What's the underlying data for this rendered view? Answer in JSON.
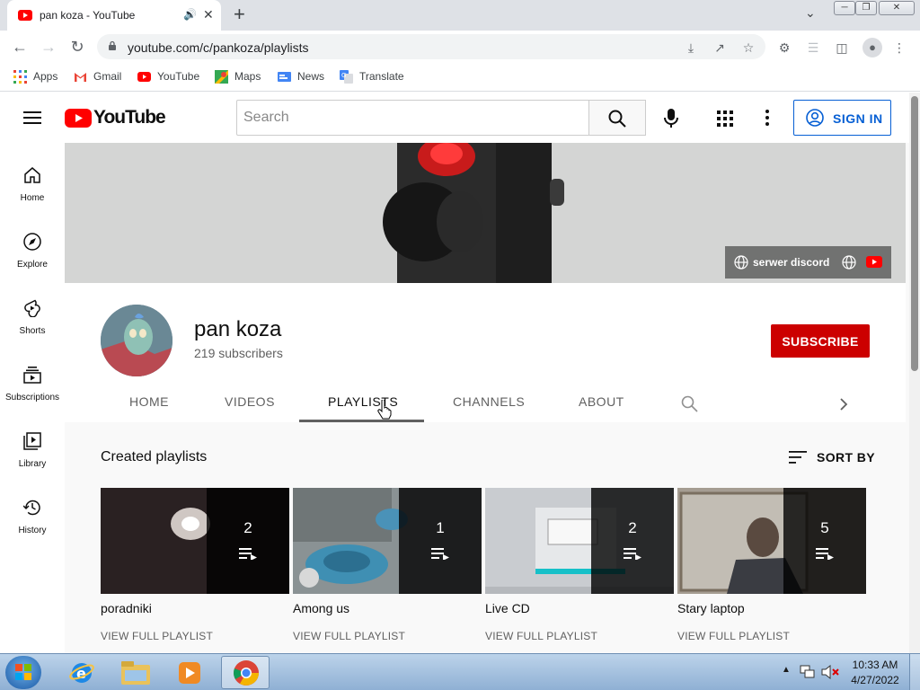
{
  "browser": {
    "tab_title": "pan koza - YouTube",
    "url": "youtube.com/c/pankoza/playlists",
    "bookmarks": [
      {
        "label": "Apps",
        "icon": "apps-grid-icon"
      },
      {
        "label": "Gmail",
        "icon": "gmail-icon"
      },
      {
        "label": "YouTube",
        "icon": "youtube-icon"
      },
      {
        "label": "Maps",
        "icon": "maps-icon"
      },
      {
        "label": "News",
        "icon": "news-icon"
      },
      {
        "label": "Translate",
        "icon": "translate-icon"
      }
    ]
  },
  "youtube": {
    "logo_text": "YouTube",
    "search_placeholder": "Search",
    "sign_in": "SIGN IN",
    "sidebar": [
      {
        "label": "Home",
        "icon": "home-icon"
      },
      {
        "label": "Explore",
        "icon": "explore-icon"
      },
      {
        "label": "Shorts",
        "icon": "shorts-icon"
      },
      {
        "label": "Subscriptions",
        "icon": "subscriptions-icon"
      },
      {
        "label": "Library",
        "icon": "library-icon"
      },
      {
        "label": "History",
        "icon": "history-icon"
      }
    ],
    "banner_link": "serwer discord",
    "channel": {
      "name": "pan koza",
      "subscribers": "219 subscribers",
      "subscribe": "SUBSCRIBE"
    },
    "tabs": [
      {
        "label": "HOME",
        "active": false
      },
      {
        "label": "VIDEOS",
        "active": false
      },
      {
        "label": "PLAYLISTS",
        "active": true
      },
      {
        "label": "CHANNELS",
        "active": false
      },
      {
        "label": "ABOUT",
        "active": false
      }
    ],
    "section_title": "Created playlists",
    "sort_by": "SORT BY",
    "playlists": [
      {
        "name": "poradniki",
        "count": "2",
        "link": "VIEW FULL PLAYLIST"
      },
      {
        "name": "Among us",
        "count": "1",
        "link": "VIEW FULL PLAYLIST"
      },
      {
        "name": "Live CD",
        "count": "2",
        "link": "VIEW FULL PLAYLIST"
      },
      {
        "name": "Stary laptop",
        "count": "5",
        "link": "VIEW FULL PLAYLIST"
      }
    ]
  },
  "taskbar": {
    "time": "10:33 AM",
    "date": "4/27/2022"
  },
  "colors": {
    "youtube_red": "#ff0000",
    "subscribe_red": "#cc0000",
    "link_blue": "#065fd4"
  }
}
